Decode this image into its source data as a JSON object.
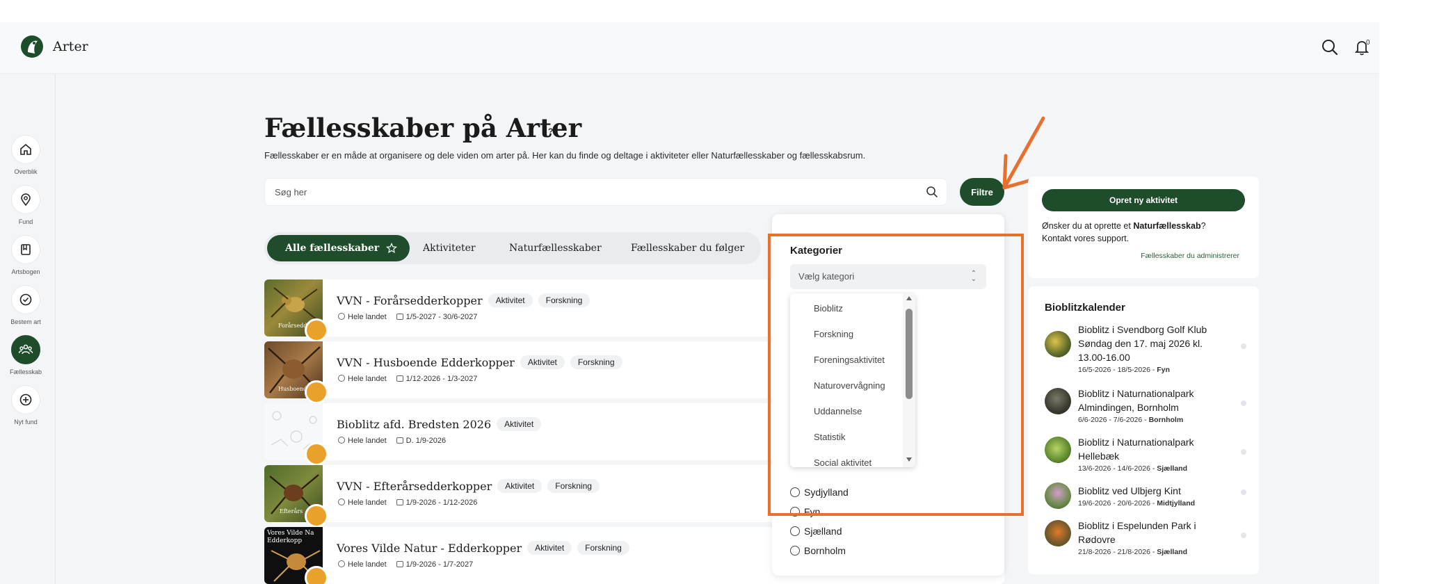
{
  "app": {
    "title": "Arter",
    "notification_count": "0"
  },
  "sidebar": {
    "items": [
      {
        "label": "Overblik",
        "icon": "home-icon"
      },
      {
        "label": "Fund",
        "icon": "map-pin-icon"
      },
      {
        "label": "Artsbogen",
        "icon": "book-icon"
      },
      {
        "label": "Bestem art",
        "icon": "check-circle-icon"
      },
      {
        "label": "Fællesskab",
        "icon": "community-icon",
        "active": true
      },
      {
        "label": "Nyt fund",
        "icon": "plus-circle-icon"
      }
    ]
  },
  "main": {
    "title": "Fællesskaber på Arter",
    "help": "?",
    "subtitle": "Fællesskaber er en måde at organisere og dele viden om arter på. Her kan du finde og deltage i aktiviteter eller Naturfællesskaber og fællesskabsrum.",
    "search_placeholder": "Søg her",
    "filter_label": "Filtre",
    "tabs": [
      {
        "label": "Alle fællesskaber",
        "active": true
      },
      {
        "label": "Aktiviteter"
      },
      {
        "label": "Naturfællesskaber"
      },
      {
        "label": "Fællesskaber du følger"
      }
    ],
    "list": [
      {
        "title": "VVN - Forårsedderkopper",
        "tags": [
          "Aktivitet",
          "Forskning"
        ],
        "location": "Hele landet",
        "dates": "1/5-2027 - 30/6-2027",
        "thumb_text": "Forårsedd."
      },
      {
        "title": "VVN - Husboende Edderkopper",
        "tags": [
          "Aktivitet",
          "Forskning"
        ],
        "location": "Hele landet",
        "dates": "1/12-2026 - 1/3-2027",
        "thumb_text": "Husboende"
      },
      {
        "title": "Bioblitz afd. Bredsten 2026",
        "tags": [
          "Aktivitet"
        ],
        "location": "Hele landet",
        "dates": "D. 1/9-2026",
        "thumb_text": ""
      },
      {
        "title": "VVN - Efterårsedderkopper",
        "tags": [
          "Aktivitet",
          "Forskning"
        ],
        "location": "Hele landet",
        "dates": "1/9-2026 - 1/12-2026",
        "thumb_text": "Efterårs"
      },
      {
        "title": "Vores Vilde Natur - Edderkopper",
        "tags": [
          "Aktivitet",
          "Forskning"
        ],
        "location": "Hele landet",
        "dates": "1/9-2026 - 1/7-2027",
        "thumb_text": "Vores Vilde Na Edderkopp"
      }
    ]
  },
  "filter_panel": {
    "category_label": "Kategorier",
    "category_placeholder": "Vælg kategori",
    "dropdown_options": [
      "Bioblitz",
      "Forskning",
      "Foreningsaktivitet",
      "Naturovervågning",
      "Uddannelse",
      "Statistik",
      "Social aktivitet"
    ],
    "regions": [
      "Sydjylland",
      "Fyn",
      "Sjælland",
      "Bornholm"
    ]
  },
  "side": {
    "create_button": "Opret ny aktivitet",
    "info_prefix": "Ønsker du at oprette et ",
    "info_bold": "Naturfællesskab",
    "info_suffix": "?",
    "info_line2": "Kontakt vores support.",
    "admin_link": "Fællesskaber du administrerer",
    "calendar_title": "Bioblitzkalender",
    "calendar": [
      {
        "name": "Bioblitz i Svendborg Golf Klub Søndag den 17. maj 2026 kl. 13.00-16.00",
        "dates": "16/5-2026 - 18/5-2026 - ",
        "region": "Fyn"
      },
      {
        "name": "Bioblitz i Naturnationalpark Almindingen, Bornholm",
        "dates": "6/6-2026 - 7/6-2026 - ",
        "region": "Bornholm"
      },
      {
        "name": "Bioblitz i Naturnationalpark Hellebæk",
        "dates": "13/6-2026 - 14/6-2026 - ",
        "region": "Sjælland"
      },
      {
        "name": "Bioblitz ved Ulbjerg Kint",
        "dates": "19/6-2026 - 20/6-2026 - ",
        "region": "Midtjylland"
      },
      {
        "name": "Bioblitz i Espelunden Park i Rødovre",
        "dates": "21/8-2026 - 21/8-2026 - ",
        "region": "Sjælland"
      }
    ]
  },
  "colors": {
    "brand_green": "#1f4d2c",
    "annotation_orange": "#e8702e"
  }
}
